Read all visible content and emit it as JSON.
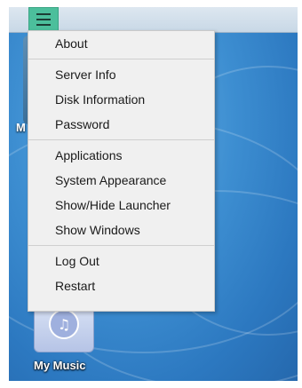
{
  "menu_button": {
    "icon": "hamburger-icon",
    "color": "#4cbf9c"
  },
  "menu": {
    "groups": [
      [
        "About"
      ],
      [
        "Server Info",
        "Disk Information",
        "Password"
      ],
      [
        "Applications",
        "System Appearance",
        "Show/Hide Launcher",
        "Show Windows"
      ],
      [
        "Log Out",
        "Restart"
      ]
    ]
  },
  "desktop": {
    "partial_label": "M",
    "music_label": "My Music",
    "music_icon": "music-note-icon"
  }
}
